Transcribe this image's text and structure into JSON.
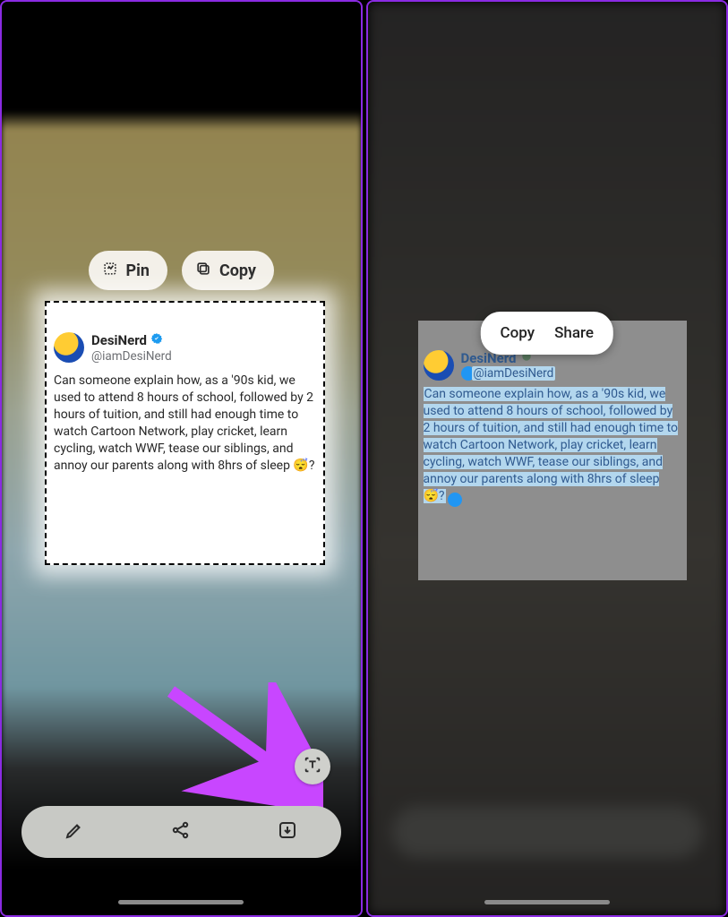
{
  "left": {
    "pin_label": "Pin",
    "copy_label": "Copy",
    "tweet": {
      "display_name": "DesiNerd",
      "handle": "@iamDesiNerd",
      "body": "Can someone explain how, as a '90s kid, we used to attend 8 hours of school, followed by 2 hours of tuition, and still had enough time to watch Cartoon Network, play cricket, learn cycling, watch WWF, tease our siblings, and annoy our parents along with 8hrs of sleep 😴?"
    },
    "toolbar": {
      "edit": "edit",
      "share": "share",
      "save": "save"
    },
    "text_extract": "text-extract"
  },
  "right": {
    "menu": {
      "copy": "Copy",
      "share": "Share"
    },
    "tweet": {
      "display_name": "DesiNerd",
      "handle": "@iamDesiNerd",
      "body": "Can someone explain how, as a '90s kid, we used to attend 8 hours of school, followed by 2 hours of tuition, and still had enough time to watch Cartoon Network, play cricket, learn cycling, watch WWF, tease our siblings, and annoy our parents along with 8hrs of sleep 😴?"
    }
  },
  "arrow_color": "#c846ff"
}
